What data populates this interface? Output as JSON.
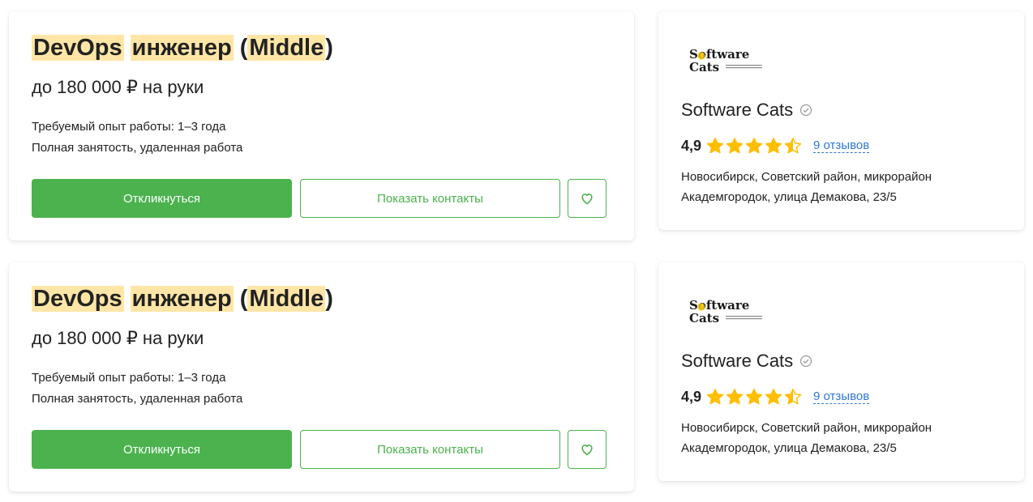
{
  "items": [
    {
      "vacancy": {
        "title_parts": [
          "DevOps",
          "инженер",
          "Middle"
        ],
        "salary": "до 180 000 ₽ на руки",
        "experience": "Требуемый опыт работы: 1–3 года",
        "employment": "Полная занятость, удаленная работа",
        "apply_label": "Откликнуться",
        "contacts_label": "Показать контакты"
      },
      "company": {
        "logo_line1": "Software",
        "logo_line2": "Cats",
        "name": "Software Cats",
        "rating": "4,9",
        "stars_filled": 4.5,
        "reviews": "9 отзывов",
        "address_line1": "Новосибирск, Советский район, микрорайон",
        "address_line2": "Академгородок, улица Демакова, 23/5"
      }
    },
    {
      "vacancy": {
        "title_parts": [
          "DevOps",
          "инженер",
          "Middle"
        ],
        "salary": "до 180 000 ₽ на руки",
        "experience": "Требуемый опыт работы: 1–3 года",
        "employment": "Полная занятость, удаленная работа",
        "apply_label": "Откликнуться",
        "contacts_label": "Показать контакты"
      },
      "company": {
        "logo_line1": "Software",
        "logo_line2": "Cats",
        "name": "Software Cats",
        "rating": "4,9",
        "stars_filled": 4.5,
        "reviews": "9 отзывов",
        "address_line1": "Новосибирск, Советский район, микрорайон",
        "address_line2": "Академгородок, улица Демакова, 23/5"
      }
    }
  ],
  "colors": {
    "accent": "#4bb24e",
    "highlight": "#ffe6a6",
    "star": "#ffbe00",
    "link": "#2f78d6"
  }
}
